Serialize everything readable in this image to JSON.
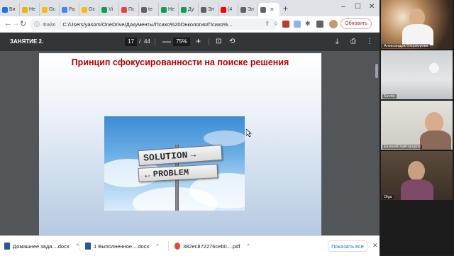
{
  "browser": {
    "tabs": [
      {
        "label": "Ви",
        "color": "#1a73e8",
        "active": false
      },
      {
        "label": "Не",
        "color": "#f4b400",
        "active": false
      },
      {
        "label": "Gc",
        "color": "#fbbc04",
        "active": false
      },
      {
        "label": "Ра",
        "color": "#4285f4",
        "active": false
      },
      {
        "label": "Gc",
        "color": "#fbbc04",
        "active": false
      },
      {
        "label": "Vi",
        "color": "#0f9d58",
        "active": false
      },
      {
        "label": "Пс",
        "color": "#ea4335",
        "active": false
      },
      {
        "label": "te",
        "color": "#5f6368",
        "active": false
      },
      {
        "label": "Не",
        "color": "#0f9d58",
        "active": false
      },
      {
        "label": "Ду",
        "color": "#0f9d58",
        "active": false
      },
      {
        "label": "Эл",
        "color": "#5f6368",
        "active": false
      },
      {
        "label": "(4",
        "color": "#ff0000",
        "active": false
      },
      {
        "label": "Эл",
        "color": "#5f6368",
        "active": false
      },
      {
        "label": "",
        "color": "#5f6368",
        "active": true
      }
    ],
    "new_tab": "+",
    "window_controls": {
      "minimize": "–",
      "maximize": "☐",
      "close": "✕"
    },
    "omnibox": {
      "info": "ⓘ",
      "scheme": "Файл",
      "url": "C:/Users/yasom/OneDrive/Документы/Психо%20Онкология/Психо%..."
    },
    "update_button": "Обновить"
  },
  "pdf": {
    "title": "ЗАНЯТИЕ 2.",
    "page_current": "17",
    "page_separator": "/",
    "page_total": "44",
    "zoom_out": "—",
    "zoom": "75%",
    "zoom_in": "+"
  },
  "slide": {
    "title": "Принцип сфокусированности на поиске решения",
    "sign_solution": "SOLUTION",
    "sign_problem": "PROBLEM",
    "arrow_right": "→",
    "arrow_left": "←"
  },
  "downloads": [
    {
      "name": "Домашнее зада....docx",
      "color": "#2b579a"
    },
    {
      "name": "1 Выполненное....docx",
      "color": "#2b579a"
    },
    {
      "name": "382ec872276ceb0....pdf",
      "color": "#ea4335"
    }
  ],
  "downloads_chevron": "^",
  "show_all": "Показать все",
  "shelf_close": "✕",
  "participants": [
    {
      "name": "Александра Охорзорова"
    },
    {
      "name": "Sevda"
    },
    {
      "name": "Евгений Кайгородов"
    },
    {
      "name": "Olga"
    }
  ]
}
